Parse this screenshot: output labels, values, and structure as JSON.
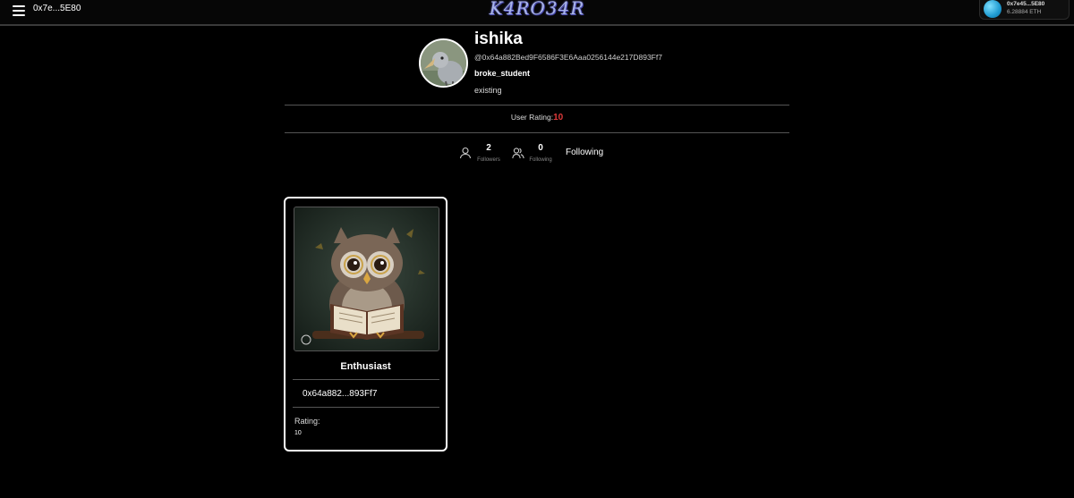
{
  "topbar": {
    "address": "0x7e...5E80",
    "logo": "K4RO34R",
    "wallet": {
      "address": "0x7e45...5E80",
      "balance": "6.28884 ETH"
    }
  },
  "profile": {
    "name": "ishika",
    "handle": "@0x64a882Bed9F6586F3E6Aaa0256144e217D893Ff7",
    "nickname": "broke_student",
    "bio": "existing",
    "rating_label": "User Rating:",
    "rating_value": "10"
  },
  "stats": {
    "followers_count": "2",
    "followers_label": "Followers",
    "following_count": "0",
    "following_label": "Following",
    "follow_button": "Following"
  },
  "card": {
    "title": "Enthusiast",
    "address": "0x64a882...893Ff7",
    "rating_label": "Rating:",
    "rating_value": "10"
  },
  "icons": {
    "menu": "hamburger-icon",
    "followers": "user-icon",
    "following": "users-icon",
    "wallet": "wallet-avatar-icon"
  },
  "colors": {
    "background": "#000000",
    "rating_accent": "#e03a3a",
    "logo": "#a8b4e8"
  }
}
